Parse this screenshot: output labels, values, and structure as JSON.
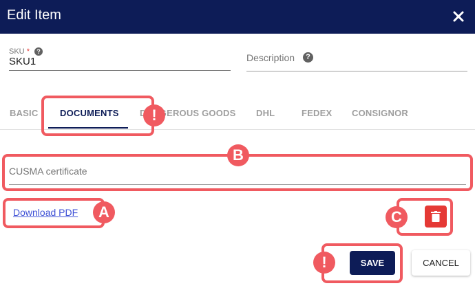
{
  "dialog": {
    "title": "Edit Item",
    "close_icon": "close-icon"
  },
  "sku": {
    "label": "SKU",
    "required_mark": "*",
    "value": "SKU1",
    "help_icon": "help-circle-icon"
  },
  "description": {
    "label": "Description",
    "help_icon": "help-circle-icon"
  },
  "tabs": [
    {
      "label": "BASIC",
      "active": false
    },
    {
      "label": "DOCUMENTS",
      "active": true
    },
    {
      "label": "DANGEROUS GOODS",
      "active": false
    },
    {
      "label": "DHL",
      "active": false
    },
    {
      "label": "FEDEX",
      "active": false
    },
    {
      "label": "CONSIGNOR",
      "active": false
    }
  ],
  "documents": {
    "certificate_label": "CUSMA certificate",
    "download_link": "Download PDF",
    "delete_icon": "trash-icon"
  },
  "actions": {
    "save": "SAVE",
    "cancel": "CANCEL"
  },
  "annotations": {
    "a": "A",
    "b": "B",
    "c": "C",
    "alert": "!",
    "color": "#f05a60"
  },
  "colors": {
    "header": "#0d1c57",
    "danger": "#e53935",
    "link": "#3f51d6"
  }
}
